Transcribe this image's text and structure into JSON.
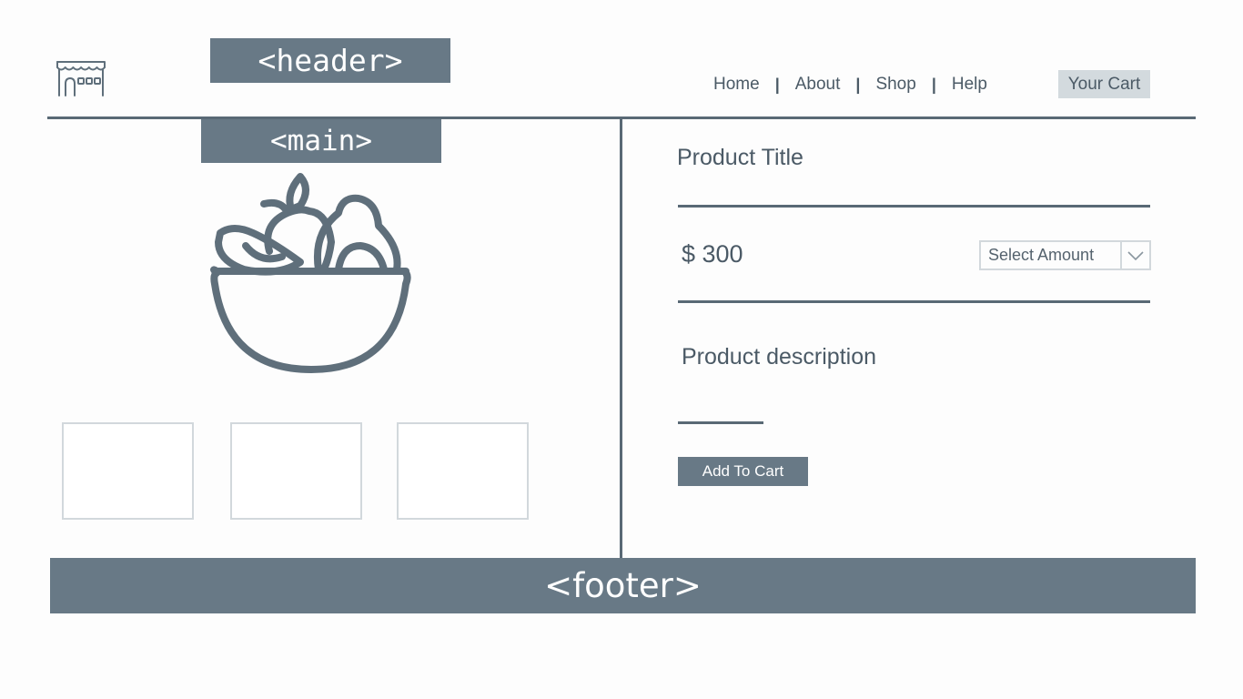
{
  "tags": {
    "header": "<header>",
    "main": "<main>",
    "footer": "<footer>"
  },
  "logo": {
    "icon": "storefront-icon"
  },
  "nav": {
    "items": [
      "Home",
      "About",
      "Shop",
      "Help"
    ],
    "separator": "|"
  },
  "cart": {
    "label": "Your Cart"
  },
  "product": {
    "title": "Product Title",
    "price": "$ 300",
    "select_amount": "Select Amount",
    "description": "Product description",
    "add_to_cart": "Add To Cart",
    "image_icon": "fruit-bowl-icon"
  },
  "thumbnails": [
    {},
    {},
    {}
  ],
  "colors": {
    "tag_bg": "#687986",
    "line": "#596975",
    "cart_bg": "#d3dade",
    "text": "#4b5a66"
  }
}
